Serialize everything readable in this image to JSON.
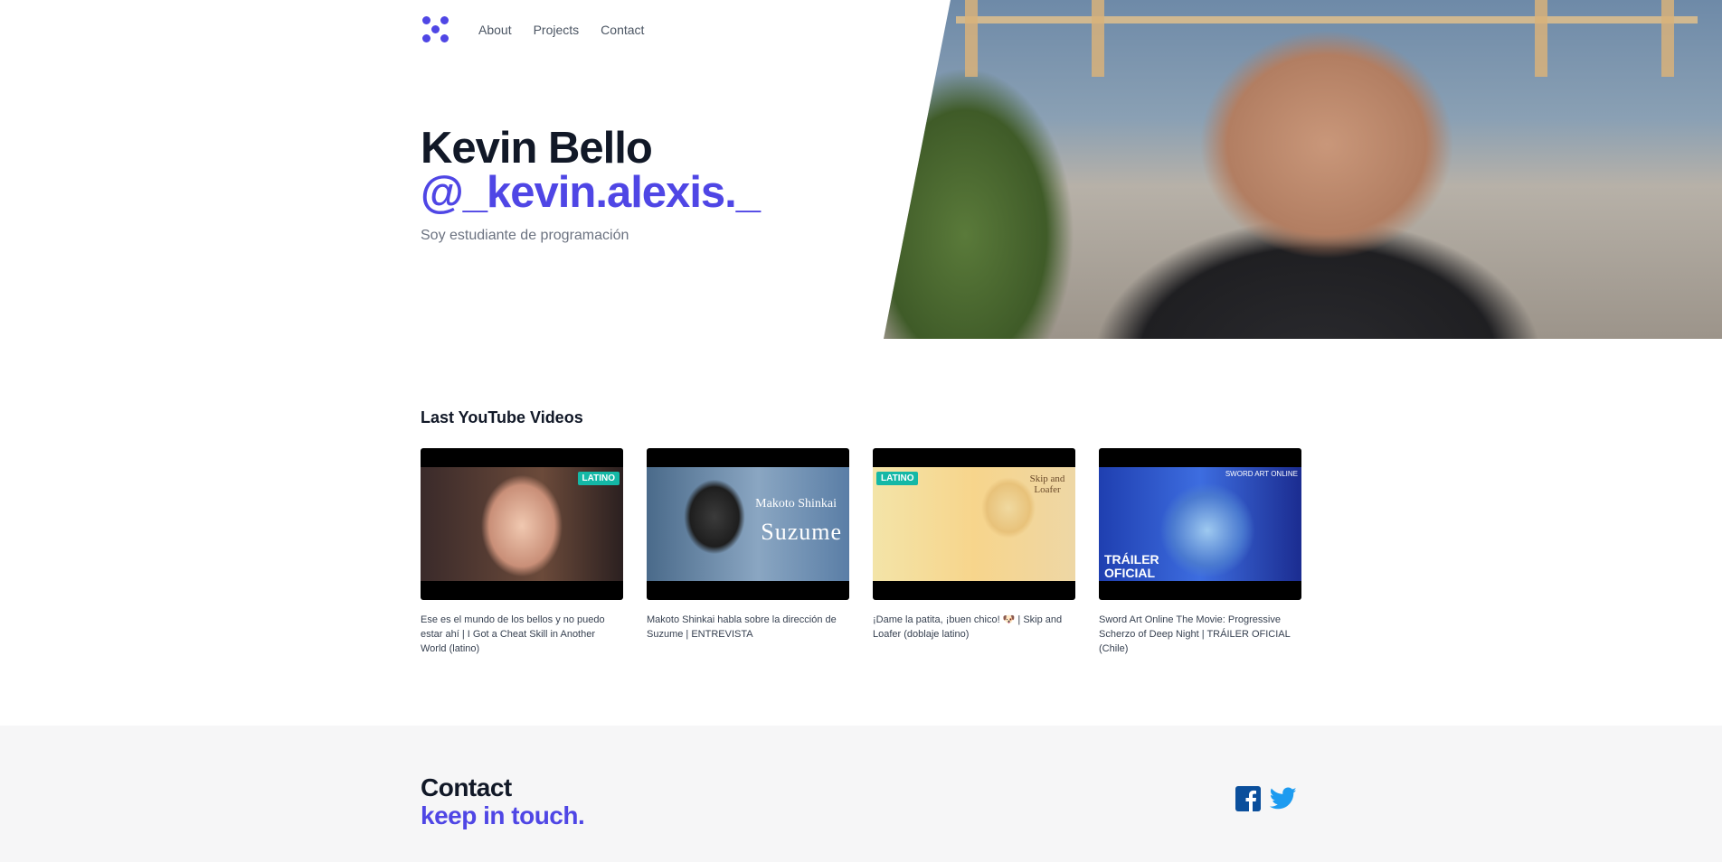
{
  "nav": {
    "links": [
      {
        "label": "About"
      },
      {
        "label": "Projects"
      },
      {
        "label": "Contact"
      }
    ]
  },
  "hero": {
    "name": "Kevin Bello",
    "handle": "@_kevin.alexis._",
    "subtitle": "Soy estudiante de programación"
  },
  "videos": {
    "title": "Last YouTube Videos",
    "items": [
      {
        "caption": "Ese es el mundo de los bellos y no puedo estar ahí | I Got a Cheat Skill in Another World (latino)",
        "badge": "LATINO"
      },
      {
        "caption": "Makoto Shinkai habla sobre la dirección de Suzume | ENTREVISTA",
        "thumb_text_1": "Makoto Shinkai",
        "thumb_text_2": "Suzume"
      },
      {
        "caption": "¡Dame la patita, ¡buen chico! 🐶 | Skip and Loafer (doblaje latino)",
        "badge": "LATINO",
        "thumb_text_1": "Skip and Loafer"
      },
      {
        "caption": "Sword Art Online The Movie: Progressive Scherzo of Deep Night | TRÁILER OFICIAL (Chile)",
        "thumb_text_1": "TRÁILER OFICIAL",
        "thumb_text_2": "SWORD ART ONLINE"
      }
    ]
  },
  "contact": {
    "title": "Contact",
    "subtitle": "keep in touch."
  },
  "social": {
    "facebook_icon": "facebook-icon",
    "twitter_icon": "twitter-icon",
    "facebook_color": "#0b4f9c",
    "twitter_color": "#1d9bf0"
  },
  "colors": {
    "accent": "#4f46e5",
    "text_dark": "#111827",
    "text_muted": "#6b7280"
  }
}
